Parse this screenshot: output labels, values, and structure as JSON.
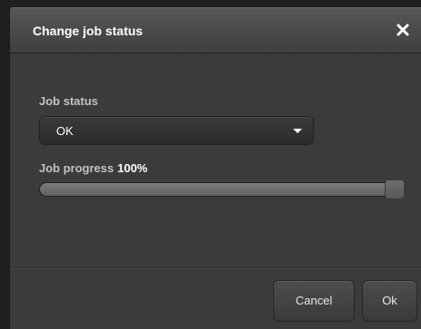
{
  "dialog": {
    "title": "Change job status",
    "close_icon": "close-icon"
  },
  "form": {
    "status_label": "Job status",
    "status_value": "OK",
    "progress_label": "Job progress",
    "progress_value_text": "100%",
    "progress_fraction": 1.0
  },
  "buttons": {
    "cancel_label": "Cancel",
    "ok_label": "Ok"
  },
  "colors": {
    "dialog_background": "#3b3b3b",
    "title_text": "#ffffff",
    "label_text": "#c2c2c2"
  }
}
